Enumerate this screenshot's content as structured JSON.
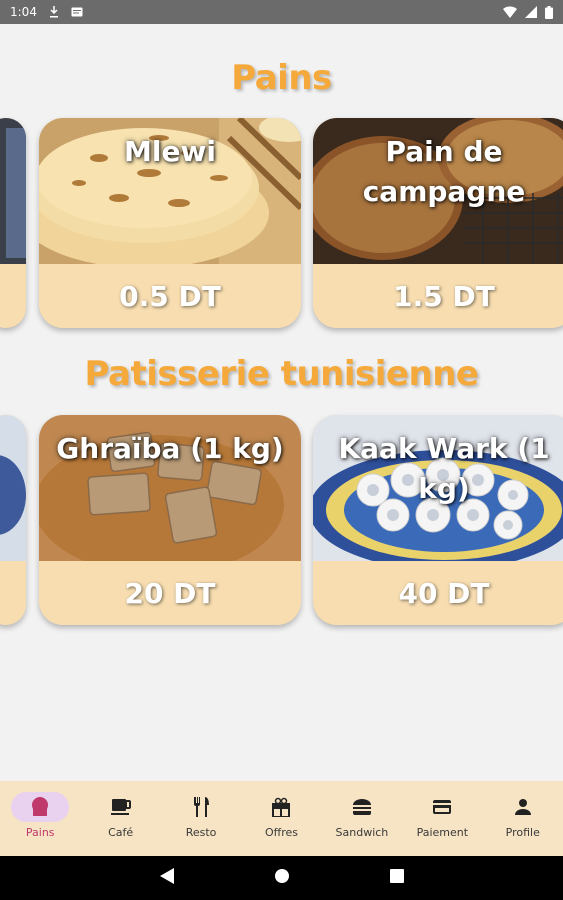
{
  "status_bar": {
    "time": "1:04"
  },
  "sections": [
    {
      "title": "Pains",
      "items": [
        {
          "name": "Mlewi",
          "price": "0.5 DT"
        },
        {
          "name": "Pain de campagne",
          "price": "1.5 DT"
        }
      ]
    },
    {
      "title": "Patisserie tunisienne",
      "items": [
        {
          "name": "Ghraïba (1 kg)",
          "price": "20 DT"
        },
        {
          "name": "Kaak Wark (1 kg)",
          "price": "40 DT"
        }
      ]
    }
  ],
  "bottom_nav": {
    "items": [
      {
        "label": "Pains",
        "icon": "bread-icon",
        "active": true
      },
      {
        "label": "Café",
        "icon": "coffee-cup-icon"
      },
      {
        "label": "Resto",
        "icon": "fork-knife-icon"
      },
      {
        "label": "Offres",
        "icon": "gift-icon"
      },
      {
        "label": "Sandwich",
        "icon": "burger-icon"
      },
      {
        "label": "Paiement",
        "icon": "credit-card-icon"
      },
      {
        "label": "Profile",
        "icon": "person-icon"
      }
    ]
  },
  "colors": {
    "accent_title": "#f4a93a",
    "card_bottom": "#f7ddb0",
    "nav_bg": "#f7e4c4",
    "nav_active": "#c0396b"
  }
}
